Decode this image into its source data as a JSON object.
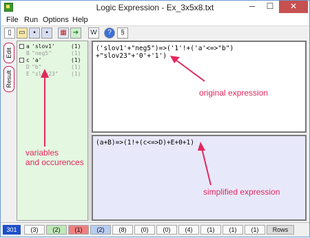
{
  "window": {
    "title": "Logic Expression - Ex_3x5x8.txt",
    "controls": {
      "minimize": "─",
      "maximize": "☐",
      "close": "✕"
    }
  },
  "menu": [
    "File",
    "Run",
    "Options",
    "Help"
  ],
  "toolbar": {
    "buttons": [
      {
        "icon": "new-file-icon",
        "glyph": "▯"
      },
      {
        "icon": "open-folder-icon",
        "glyph": "▭"
      },
      {
        "icon": "save-icon",
        "glyph": "▪"
      },
      {
        "icon": "save-as-icon",
        "glyph": "▪"
      },
      {
        "icon": "run-icon",
        "glyph": "▦"
      },
      {
        "icon": "export-icon",
        "glyph": "➔"
      },
      {
        "icon": "word-icon",
        "glyph": "W"
      },
      {
        "icon": "help-icon",
        "glyph": "?"
      },
      {
        "icon": "section-icon",
        "glyph": "§"
      }
    ]
  },
  "tabs": [
    {
      "label": "Edit"
    },
    {
      "label": "Result"
    }
  ],
  "variables": [
    {
      "checked": false,
      "letter": "a",
      "name": "'slov1'",
      "count": "(1)",
      "active": true
    },
    {
      "checked": false,
      "letter": "B",
      "name": "\"neg5\"",
      "count": "(1)",
      "active": false
    },
    {
      "checked": false,
      "letter": "c",
      "name": "'a'",
      "count": "(1)",
      "active": true
    },
    {
      "checked": false,
      "letter": "D",
      "name": "\"b\"",
      "count": "(1)",
      "active": false
    },
    {
      "checked": false,
      "letter": "E",
      "name": "\"slov23\"",
      "count": "(1)",
      "active": false
    }
  ],
  "original_expression": "('slov1'+\"neg5\")=>('1'!+('a'<=>\"b\")\n+\"slov23\"+'0'+'1')",
  "simplified_expression": "(a+B)=>(1!+(c<=>D)+E+0+1)",
  "status": {
    "cells": [
      "301",
      "(3)",
      "(2)",
      "(1)",
      "(2)",
      "(8)",
      "(0)",
      "(0)",
      "(4)",
      "(1)",
      "(1)",
      "(1)",
      "Rows"
    ]
  },
  "annotations": {
    "original": "original expression",
    "simplified": "simplified expression",
    "variables": "variables\nand occurences",
    "color": "#e2275c"
  },
  "colors": {
    "variables_bg": "#e4f7e0",
    "simplified_bg": "#e8e8fb",
    "status_blue": "#1f4fc8",
    "status_red": "#f08080",
    "status_green": "#bfe8b8",
    "status_lightblue": "#b8cdf2"
  }
}
